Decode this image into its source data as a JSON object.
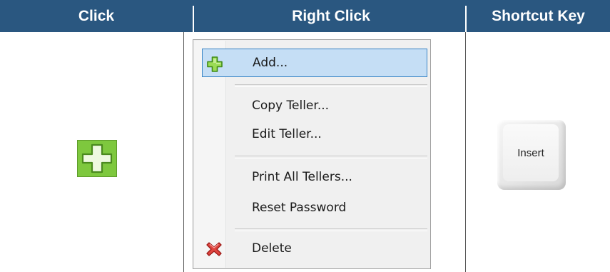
{
  "header": {
    "click": "Click",
    "right_click": "Right Click",
    "shortcut_key": "Shortcut Key"
  },
  "context_menu": {
    "items": [
      {
        "label": "Add...",
        "icon": "green-plus-icon",
        "selected": true
      },
      {
        "label": "Copy Teller..."
      },
      {
        "label": "Edit Teller..."
      },
      {
        "label": "Print All Tellers..."
      },
      {
        "label": "Reset Password"
      },
      {
        "label": "Delete",
        "icon": "red-x-icon"
      }
    ]
  },
  "shortcut": {
    "key_label": "Insert"
  },
  "colors": {
    "header_bg": "#2a5780",
    "selection_bg": "#c5def5",
    "selection_border": "#3a85c5",
    "plus_green": "#7ec83e",
    "delete_red": "#d9262b"
  }
}
